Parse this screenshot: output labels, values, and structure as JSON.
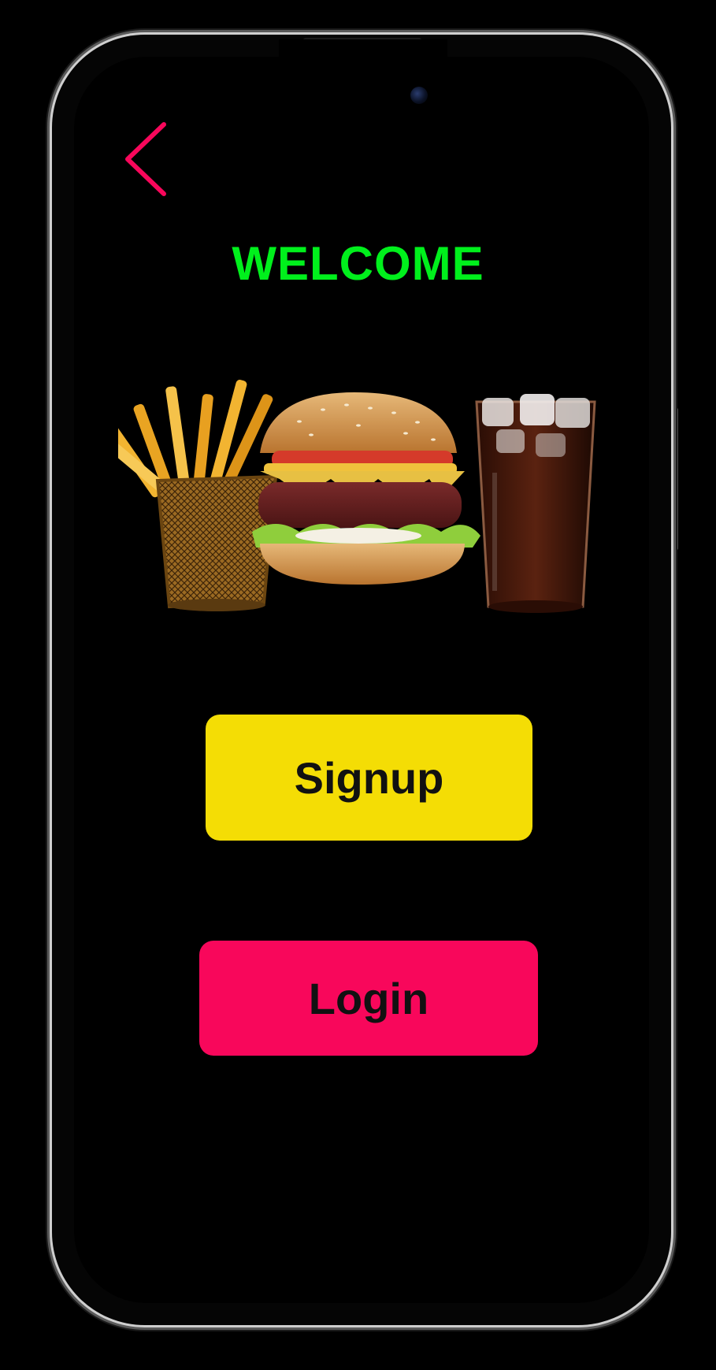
{
  "screen": {
    "title": "WELCOME",
    "hero_image": "burger-fries-soda-photo"
  },
  "nav": {
    "back_icon": "chevron-left-icon"
  },
  "buttons": {
    "signup_label": "Signup",
    "login_label": "Login"
  },
  "colors": {
    "background": "#000000",
    "title": "#00f01c",
    "back_icon": "#f8075b",
    "signup_bg": "#f4dd05",
    "login_bg": "#f8075b",
    "button_text": "#111111"
  }
}
